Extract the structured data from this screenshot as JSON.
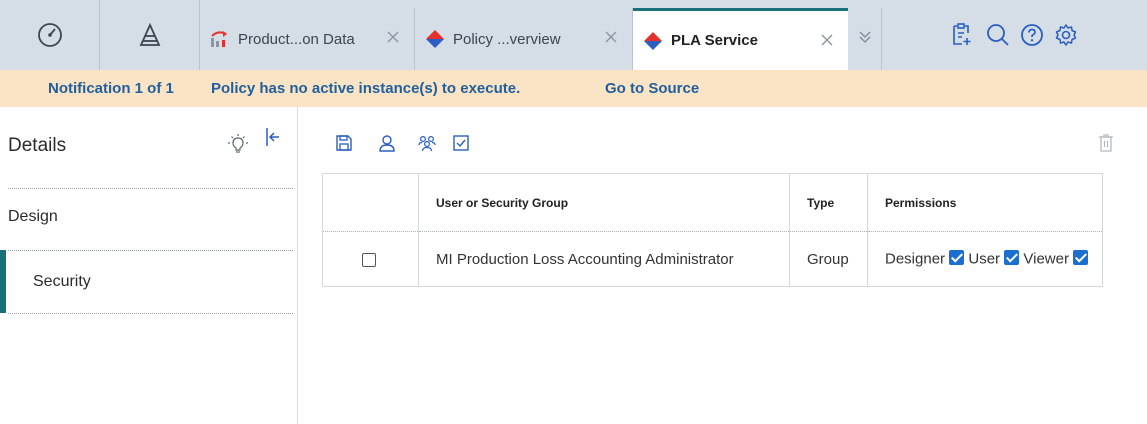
{
  "topbar": {
    "nav": [
      {
        "name": "dashboard-icon"
      },
      {
        "name": "hierarchy-icon"
      }
    ],
    "tabs": [
      {
        "label": "Product...on Data",
        "icon": "production-chart-icon",
        "active": false
      },
      {
        "label": "Policy ...verview",
        "icon": "policy-diamond-icon",
        "active": false
      },
      {
        "label": "PLA Service",
        "icon": "policy-diamond-icon",
        "active": true
      }
    ],
    "tools": [
      "new-document-icon",
      "search-icon",
      "help-icon",
      "settings-gear-icon"
    ],
    "colors": {
      "active_tab_accent": "#19707a",
      "diamond_red": "#e5312c",
      "diamond_blue": "#2a5ec2"
    }
  },
  "notification": {
    "counter": "Notification 1 of 1",
    "message": "Policy has no active instance(s) to execute.",
    "link": "Go to Source"
  },
  "sidebar": {
    "title": "Details",
    "items": [
      {
        "label": "Design",
        "selected": false
      },
      {
        "label": "Security",
        "selected": true
      }
    ]
  },
  "toolbar": {
    "icons": [
      "save-icon",
      "add-user-icon",
      "add-group-icon",
      "check-permissions-icon",
      "delete-icon"
    ]
  },
  "grid": {
    "columns": [
      "",
      "User or Security Group",
      "Type",
      "Permissions"
    ],
    "rows": [
      {
        "selected": false,
        "name": "MI Production Loss Accounting Administrator",
        "type": "Group",
        "permissions": [
          {
            "label": "Designer",
            "checked": true
          },
          {
            "label": "User",
            "checked": true
          },
          {
            "label": "Viewer",
            "checked": true
          }
        ]
      }
    ]
  }
}
